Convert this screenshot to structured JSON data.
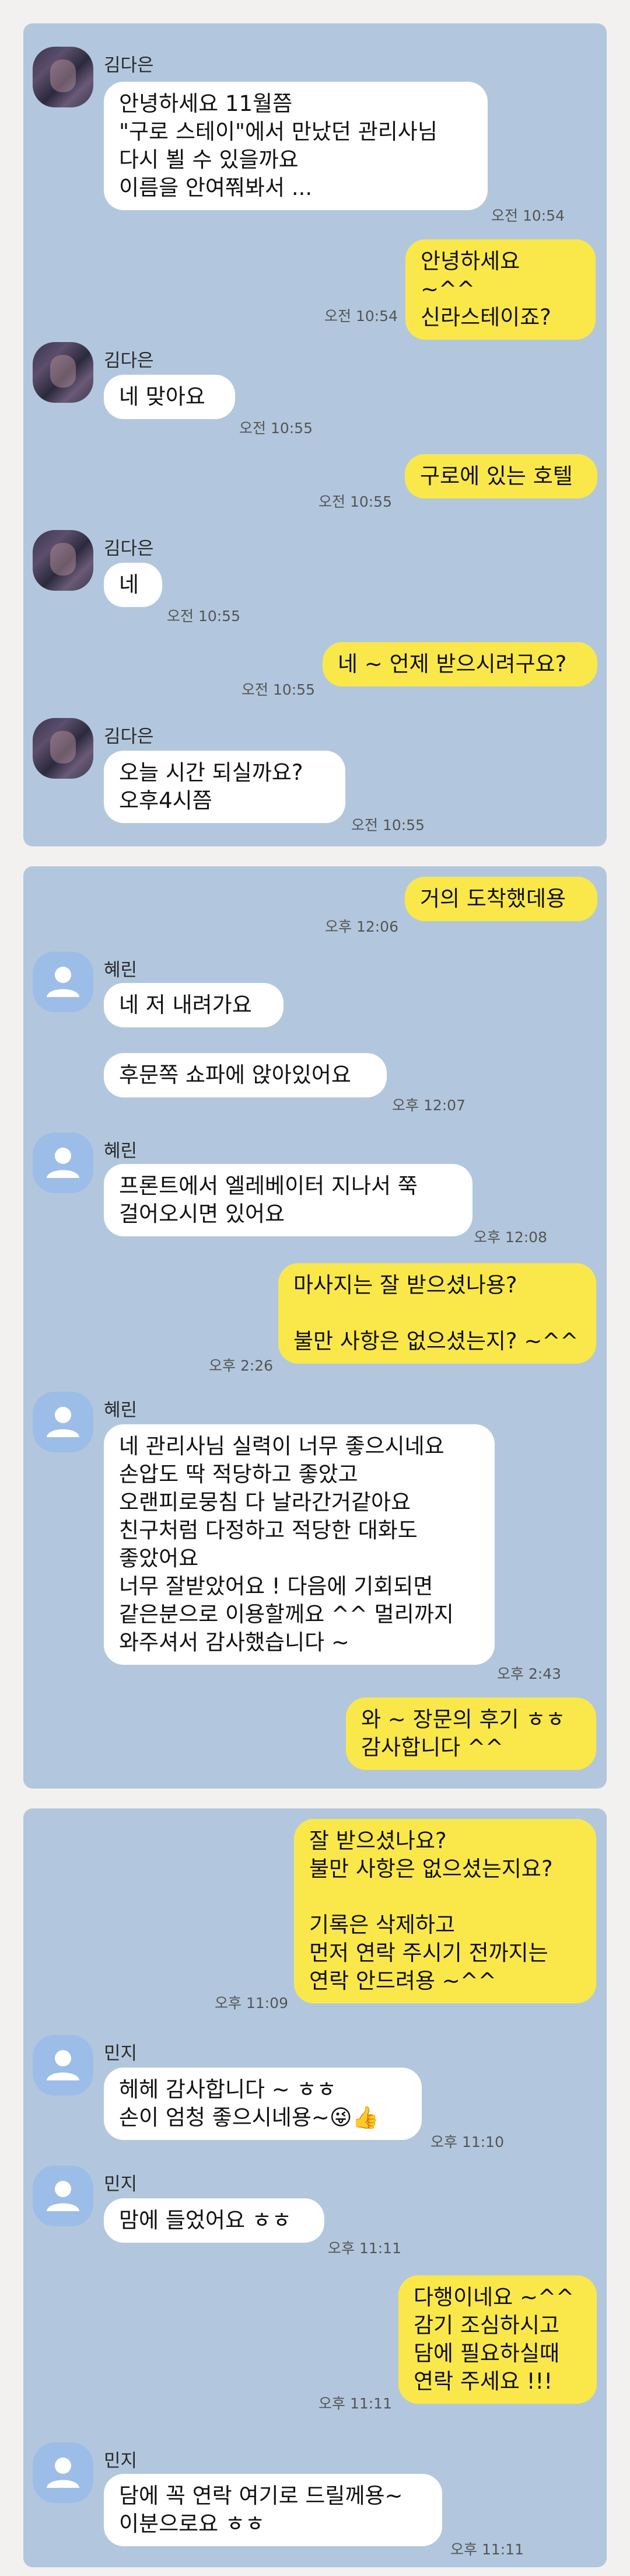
{
  "colors": {
    "page_background": "#f2f1ef",
    "chat_background": "#b2c7dd",
    "incoming_bubble": "#ffffff",
    "outgoing_bubble": "#fae84a",
    "default_avatar": "#9cbde8"
  },
  "icons": {
    "blurred_profile": "avatar-icon",
    "default_profile": "person-icon"
  },
  "panels": [
    {
      "messages": [
        {
          "sender": "김다은",
          "text": "안녕하세요 11월쯤\n\"구로 스테이\"에서 만났던 관리사님\n다시 뵐 수 있을까요\n이름을 안여쭤봐서 ...",
          "time": "오전 10:54"
        },
        {
          "sender": "me",
          "text": "안녕하세요 ~^^\n신라스테이죠?",
          "time": "오전 10:54"
        },
        {
          "sender": "김다은",
          "text": "네 맞아요",
          "time": "오전 10:55"
        },
        {
          "sender": "me",
          "text": "구로에 있는 호텔",
          "time": "오전 10:55"
        },
        {
          "sender": "김다은",
          "text": "네",
          "time": "오전 10:55"
        },
        {
          "sender": "me",
          "text": "네 ~ 언제 받으시려구요?",
          "time": "오전 10:55"
        },
        {
          "sender": "김다은",
          "text": "오늘  시간 되실까요?\n오후4시쯤",
          "time": "오전 10:55"
        }
      ]
    },
    {
      "messages": [
        {
          "sender": "me",
          "text": "거의 도착했데용",
          "time": "오후 12:06"
        },
        {
          "sender": "혜린",
          "text": "네 저 내려가요",
          "time": ""
        },
        {
          "sender": "혜린",
          "text": "후문쪽 쇼파에 앉아있어요",
          "time": "오후 12:07"
        },
        {
          "sender": "혜린",
          "text": "프론트에서 엘레베이터 지나서 쭉\n걸어오시면 있어요",
          "time": "오후 12:08"
        },
        {
          "sender": "me",
          "text": "마사지는 잘 받으셨나용?\n\n불만 사항은 없으셨는지? ~^^",
          "time": "오후 2:26"
        },
        {
          "sender": "혜린",
          "text": "네 관리사님 실력이 너무 좋으시네요\n손압도 딱 적당하고 좋았고\n오랜피로뭉침 다 날라간거같아요\n친구처럼 다정하고 적당한 대화도\n좋았어요\n너무 잘받았어요 ! 다음에 기회되면\n같은분으로 이용할께요 ^^ 멀리까지\n와주셔서 감사했습니다 ~",
          "time": "오후 2:43"
        },
        {
          "sender": "me",
          "text": "와 ~ 장문의 후기 ㅎㅎ\n감사합니다 ^^",
          "time": ""
        }
      ]
    },
    {
      "messages": [
        {
          "sender": "me",
          "text": "잘 받으셨나요?\n불만 사항은 없으셨는지요?\n\n기록은 삭제하고\n먼저 연락 주시기 전까지는\n연락 안드려용 ~^^",
          "time": "오후 11:09"
        },
        {
          "sender": "민지",
          "text": "헤헤 감사합니다 ~ ㅎㅎ\n손이 엄청 좋으시네용~😜👍",
          "time": "오후 11:10"
        },
        {
          "sender": "민지",
          "text": "맘에 들었어요 ㅎㅎ",
          "time": "오후 11:11"
        },
        {
          "sender": "me",
          "text": "다행이네요 ~^^\n감기 조심하시고\n담에 필요하실때\n연락 주세요 !!!",
          "time": "오후 11:11"
        },
        {
          "sender": "민지",
          "text": "담에 꼭 연락 여기로 드릴께용~\n이분으로요 ㅎㅎ",
          "time": "오후 11:11"
        }
      ]
    }
  ]
}
